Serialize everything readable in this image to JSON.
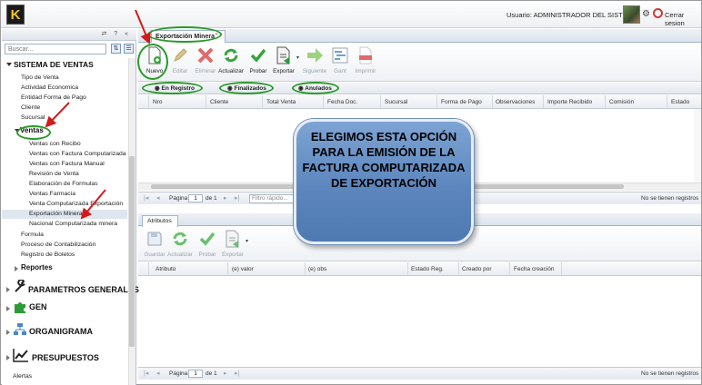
{
  "topbar": {
    "logo_letter": "K",
    "user_label": "Usuario: ADMINISTRADOR DEL SISTEMA",
    "logout_label": "Cerrar sesion"
  },
  "sidebar": {
    "tools": "⇄ ? «",
    "search_placeholder": "Buscar...",
    "section_title": "SISTEMA DE VENTAS",
    "items": [
      "Tipo de Venta",
      "Actividad Economica",
      "Entidad Forma de Pago",
      "Cliente",
      "Sucursal"
    ],
    "ventas_label": "Ventas",
    "ventas_items": [
      "Ventas con Recibo",
      "Ventas con Factura Computarizada",
      "Ventas con Factura Manual",
      "Revisión de Venta",
      "Elaboración de Formulas",
      "Ventas Farmacia",
      "Venta Computarizada Exportación",
      "Exportación Minera",
      "Nacional Computarizada minera"
    ],
    "after_items": [
      "Formula",
      "Proceso de Contabilización",
      "Registro de Boletos"
    ],
    "reportes_label": "Reportes",
    "groups": [
      "PARAMETROS GENERALES",
      "GEN",
      "ORGANIGRAMA",
      "PRESUPUESTOS"
    ],
    "last_item": "Alertas"
  },
  "main": {
    "tab_label": "Exportación Minera",
    "toolbar": [
      {
        "label": "Nuevo",
        "icon": "new-document-icon"
      },
      {
        "label": "Editar",
        "icon": "pencil-icon"
      },
      {
        "label": "Eliminar",
        "icon": "delete-x-icon"
      },
      {
        "label": "Actualizar",
        "icon": "refresh-icon"
      },
      {
        "label": "Probar",
        "icon": "check-icon"
      },
      {
        "label": "Exportar",
        "icon": "export-icon"
      },
      {
        "label": "Siguiente",
        "icon": "next-arrow-icon"
      },
      {
        "label": "Gant",
        "icon": "gantt-icon"
      },
      {
        "label": "Imprimir",
        "icon": "pdf-icon"
      }
    ],
    "filters": [
      "En Registro",
      "Finalizados",
      "Anulados"
    ],
    "columns": [
      "Nro",
      "Cliente",
      "Total Venta",
      "Fecha Doc.",
      "Sucursal",
      "Forma de Pago",
      "Observaciones",
      "Importe Recibido",
      "Comisión",
      "Estado"
    ],
    "pager": {
      "page_label": "Página",
      "page_value": "1",
      "of_label": "de 1",
      "quick_placeholder": "Filtro rápido...",
      "empty_label": "No se tienen registros"
    },
    "attr_tab_label": "Atributos",
    "attr_toolbar": [
      {
        "label": "Guardar",
        "icon": "save-icon"
      },
      {
        "label": "Actualizar",
        "icon": "refresh-icon"
      },
      {
        "label": "Probar",
        "icon": "check-icon"
      },
      {
        "label": "Exportar",
        "icon": "export-icon"
      }
    ],
    "attr_columns": [
      "Atributo",
      "(e) valor",
      "(e) obs",
      "Estado Reg.",
      "Creado por",
      "Fecha creación"
    ],
    "attr_pager": {
      "page_label": "Página",
      "page_value": "1",
      "of_label": "de 1",
      "empty_label": "No se tienen registros"
    }
  },
  "callout": {
    "text": "ELEGIMOS ESTA OPCIÓN PARA LA EMISIÓN DE LA FACTURA COMPUTARIZADA DE EXPORTACIÓN"
  },
  "colors": {
    "accent_green": "#2a9a2a",
    "arrow_red": "#d11a1a",
    "callout_blue": "#5c86bd"
  }
}
